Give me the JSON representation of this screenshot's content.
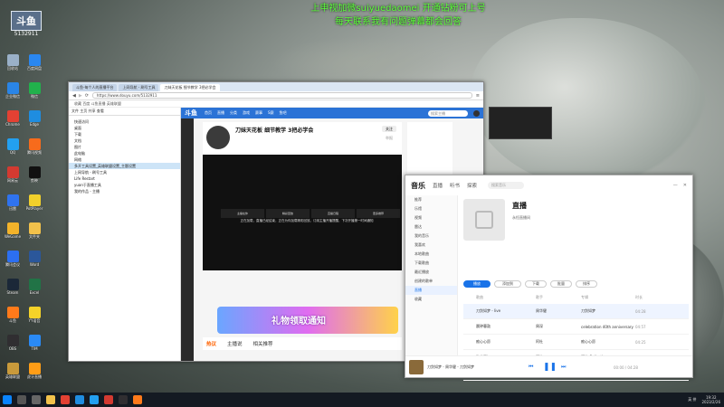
{
  "overlay": {
    "line1": "上申视加微suiyuedaomei 开通钻粉可上号",
    "line2": "每天联系我有问题弹幕都会回答"
  },
  "stream_logo": {
    "name": "斗鱼",
    "room_id": "5132911"
  },
  "desktop_icons": [
    {
      "label": "回收站",
      "color": "#9ab0c8"
    },
    {
      "label": "企业微信",
      "color": "#2a85e6"
    },
    {
      "label": "Chrome",
      "color": "#e34133"
    },
    {
      "label": "QQ",
      "color": "#23a0f0"
    },
    {
      "label": "网易云",
      "color": "#d33a31"
    },
    {
      "label": "迅雷",
      "color": "#2f73ef"
    },
    {
      "label": "WeGame",
      "color": "#f3b32a"
    },
    {
      "label": "腾讯会议",
      "color": "#2c6ff1"
    },
    {
      "label": "Steam",
      "color": "#1b2838"
    },
    {
      "label": "斗鱼",
      "color": "#ff7a1a"
    },
    {
      "label": "OBS",
      "color": "#302e31"
    },
    {
      "label": "英雄联盟",
      "color": "#c99a3b"
    },
    {
      "label": "百度网盘",
      "color": "#2a87f0"
    },
    {
      "label": "微信",
      "color": "#22b14c"
    },
    {
      "label": "Edge",
      "color": "#1f8de0"
    },
    {
      "label": "腾讯视频",
      "color": "#f76b1c"
    },
    {
      "label": "剪映",
      "color": "#111111"
    },
    {
      "label": "PotPlayer",
      "color": "#f2d02b"
    },
    {
      "label": "文件夹",
      "color": "#f2c14b"
    },
    {
      "label": "Word",
      "color": "#2b579a"
    },
    {
      "label": "Excel",
      "color": "#217346"
    },
    {
      "label": "YY语音",
      "color": "#f5d329"
    },
    {
      "label": "TIM",
      "color": "#2a8af6"
    },
    {
      "label": "虎牙直播",
      "color": "#ff9d16"
    }
  ],
  "explorer": {
    "toolbar": "文件  主页  共享  查看",
    "items": [
      "快速访问",
      "桌面",
      "下载",
      "文档",
      "图片",
      "此电脑",
      "网络",
      "多开工具设置_英雄联盟设置_主题设置",
      "上网导航 - 刷号工具",
      "Life Restart",
      "yuan于直播工具",
      "我的作品 - 主播"
    ],
    "selected_index": 7
  },
  "browser": {
    "tabs": [
      "斗鱼-每个人的直播平台",
      "上网导航 - 刷号工具",
      "刀妹天花板 细节教学 3把必学会"
    ],
    "active_tab": 2,
    "url": "https://www.douyu.com/5132911",
    "favorites": "收藏  百度  斗鱼直播  英雄联盟"
  },
  "douyu": {
    "logo": "斗鱼",
    "nav": [
      "首页",
      "直播",
      "分类",
      "游戏",
      "赛事",
      "S赛",
      "鱼吧"
    ],
    "search_placeholder": "搜索主播",
    "room_title": "刀妹天花板 细节教学 3把必学会",
    "player_cells": [
      "主播在休",
      "精彩回放",
      "直播日程",
      "更多推荐"
    ],
    "player_message": "正在加载，直播已经结束，正在为你加载精彩回放。订阅主播开播提醒，下次开播第一时间通知",
    "tabs": [
      "热议",
      "主播说",
      "相关推荐"
    ],
    "active_tab": 0,
    "banner_text": "礼物领取通知",
    "follow_button": "关注",
    "report_button": "举报"
  },
  "music": {
    "tabs": [
      "音乐",
      "直播",
      "听书",
      "探索"
    ],
    "active_tab": 0,
    "search_placeholder": "搜索音乐",
    "sidebar": [
      "推荐",
      "乐馆",
      "视频",
      "雷达",
      "我的音乐",
      "我喜欢",
      "本地歌曲",
      "下载歌曲",
      "最近播放",
      "创建的歌单",
      "直播",
      "收藏"
    ],
    "selected_side": 10,
    "playlist_title": "直播",
    "playlist_owner": "永恒直播间",
    "buttons": {
      "play_all": "播放",
      "add_to": "添加到",
      "download": "下载",
      "batch": "批量",
      "sort": "排序"
    },
    "columns": [
      "歌曲",
      "歌手",
      "专辑",
      "时长"
    ],
    "rows": [
      {
        "title": "刀剑如梦 - live",
        "artist": "周华健",
        "album": "刀剑如梦",
        "duration": "04:28"
      },
      {
        "title": "晨钟暮鼓",
        "artist": "周深",
        "album": "celebration 40th anniversary",
        "duration": "04:57"
      },
      {
        "title": "痴心心愿",
        "artist": "阿杜",
        "album": "痴心心愿",
        "duration": "04:25"
      },
      {
        "title": "秋的回忆",
        "artist": "阿杜",
        "album": "阿杜 Collection",
        "duration": "04:18"
      },
      {
        "title": "今夜你会不会来",
        "artist": "黎明",
        "album": "今夜你会不会来",
        "duration": "04:31"
      }
    ],
    "selected_row": 0,
    "now_playing": "刀剑如梦 - 周华健 - 刀剑如梦",
    "time": "00:00 / 04:28"
  },
  "taskbar": {
    "icons": [
      "start",
      "search",
      "task-view",
      "explorer",
      "chrome",
      "edge",
      "qq",
      "music",
      "obs",
      "douyu"
    ],
    "tray_text": "英 拼",
    "time": "19:32",
    "date": "2023/2/26"
  }
}
